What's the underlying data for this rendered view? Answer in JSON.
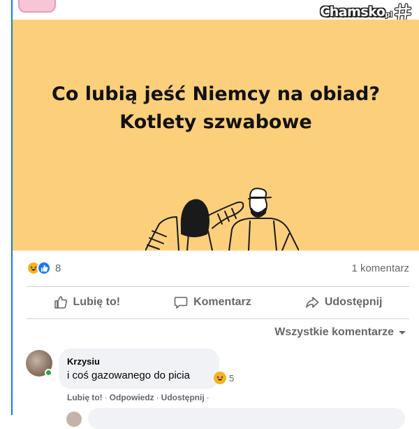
{
  "brand": {
    "logo_text": "Chamsko",
    "logo_suffix": "pl"
  },
  "post": {
    "image_text_line1": "Co lubią jeść Niemcy na obiad?",
    "image_text_line2": "Kotlety szwabowe",
    "image_bg_color": "#fccf7b"
  },
  "stats": {
    "reactions_count": "8",
    "reaction_icons": [
      "haha-icon",
      "like-icon"
    ],
    "comments_count": "1 komentarz"
  },
  "actions": {
    "like": "Lubię to!",
    "comment": "Komentarz",
    "share": "Udostępnij"
  },
  "comments_filter": {
    "label": "Wszystkie komentarze"
  },
  "comment": {
    "author": "Krzysiu",
    "text": "i coś gazowanego do picia",
    "reaction_count": "5",
    "online": true,
    "actions": {
      "like": "Lubię to!",
      "reply": "Odpowiedz",
      "share": "Udostępnij",
      "separator": "·"
    }
  },
  "colors": {
    "accent": "#1877f2",
    "secondary_text": "#65676b",
    "online": "#31a24c"
  }
}
